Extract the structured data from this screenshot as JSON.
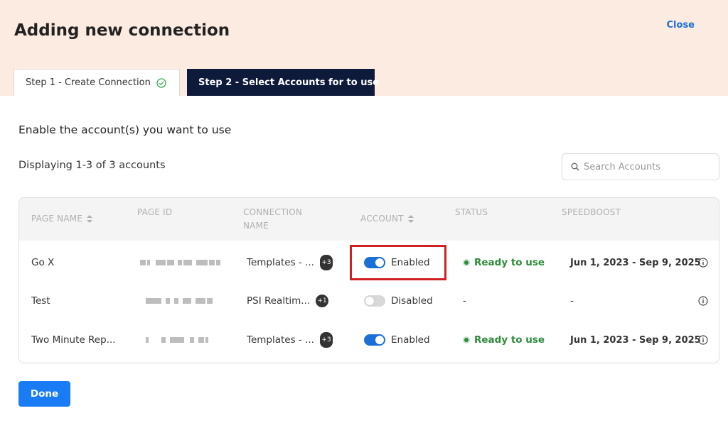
{
  "header": {
    "title": "Adding new connection",
    "close_label": "Close"
  },
  "tabs": [
    {
      "label": "Step 1 - Create Connection",
      "completed": true
    },
    {
      "label": "Step 2 - Select Accounts for to use",
      "active": true
    }
  ],
  "main": {
    "heading": "Enable the account(s) you want to use",
    "count_text": "Displaying 1-3 of 3 accounts",
    "search_placeholder": "Search Accounts"
  },
  "table": {
    "columns": {
      "page_name": "PAGE NAME",
      "page_id": "PAGE ID",
      "connection_name_1": "CONNECTION",
      "connection_name_2": "NAME",
      "account": "ACCOUNT",
      "status": "STATUS",
      "speedboost": "SPEEDBOOST"
    },
    "rows": [
      {
        "page_name": "Go X",
        "connection": "Templates - ...",
        "badge": "+3",
        "account": "Enabled",
        "enabled": true,
        "status": "Ready to use",
        "speedboost": "Jun 1, 2023 - Sep 9, 2025"
      },
      {
        "page_name": "Test",
        "connection": "PSI Realtim...",
        "badge": "+1",
        "account": "Disabled",
        "enabled": false,
        "status": "-",
        "speedboost": "-"
      },
      {
        "page_name": "Two Minute Rep...",
        "connection": "Templates - ...",
        "badge": "+3",
        "account": "Enabled",
        "enabled": true,
        "status": "Ready to use",
        "speedboost": "Jun 1, 2023 - Sep 9, 2025"
      }
    ]
  },
  "footer": {
    "done_label": "Done"
  },
  "colors": {
    "header_bg": "#fcebe0",
    "active_tab_bg": "#0e1a3a",
    "accent_blue": "#1a6fd8",
    "status_green": "#2e8b3a",
    "highlight_red": "#d02020"
  },
  "icons": {
    "tab1_check": "check-circle-icon",
    "search": "search-icon",
    "sort": "sort-icon",
    "info": "info-icon"
  }
}
